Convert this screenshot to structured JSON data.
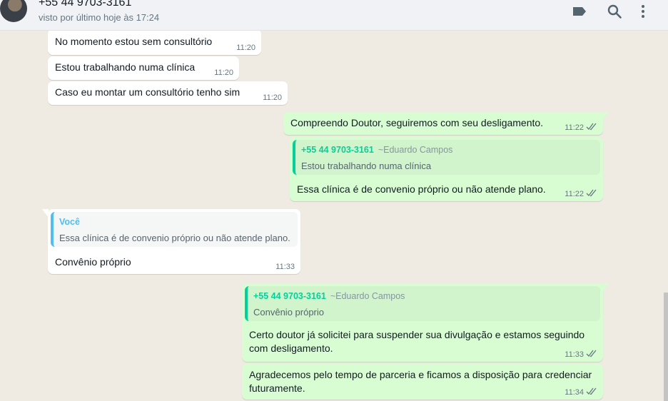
{
  "header": {
    "contact_name": "+55 44 9703-3161",
    "last_seen": "visto por último hoje às 17:24",
    "icons": [
      "label-icon",
      "search-icon",
      "more-vertical-icon"
    ]
  },
  "colors": {
    "chat_background": "#efeae2",
    "incoming_bubble": "#ffffff",
    "outgoing_bubble": "#d9fdd3",
    "quote_author_green": "#06cf9c",
    "quote_author_blue": "#53bdeb",
    "read_ticks": "#667781"
  },
  "messages": [
    {
      "direction": "in",
      "text": "No momento estou sem consultório",
      "time": "11:20"
    },
    {
      "direction": "in",
      "text": "Estou trabalhando numa clínica",
      "time": "11:20"
    },
    {
      "direction": "in",
      "text": "Caso eu montar um consultório tenho sim",
      "time": "11:20"
    },
    {
      "direction": "out",
      "text": "Compreendo Doutor, seguiremos com seu desligamento.",
      "time": "11:22",
      "status": "read-ticks-icon"
    },
    {
      "direction": "out",
      "quote": {
        "author": "+55 44 9703-3161",
        "pushname": "~Eduardo Campos",
        "text": "Estou trabalhando numa clínica"
      },
      "text": "Essa clínica é de convenio próprio ou não atende plano.",
      "time": "11:22",
      "status": "read-ticks-icon"
    },
    {
      "direction": "in",
      "quote": {
        "author": "Você",
        "text": "Essa clínica é de convenio próprio ou não atende plano."
      },
      "text": "Convênio próprio",
      "time": "11:33"
    },
    {
      "direction": "out",
      "quote": {
        "author": "+55 44 9703-3161",
        "pushname": "~Eduardo Campos",
        "text": "Convênio próprio"
      },
      "text": "Certo doutor já solicitei para suspender sua divulgação e estamos seguindo com desligamento.",
      "time": "11:33",
      "status": "read-ticks-icon"
    },
    {
      "direction": "out",
      "text": "Agradecemos pelo tempo de parceria e ficamos a disposição para credenciar futuramente.",
      "time": "11:34",
      "status": "read-ticks-icon"
    }
  ]
}
